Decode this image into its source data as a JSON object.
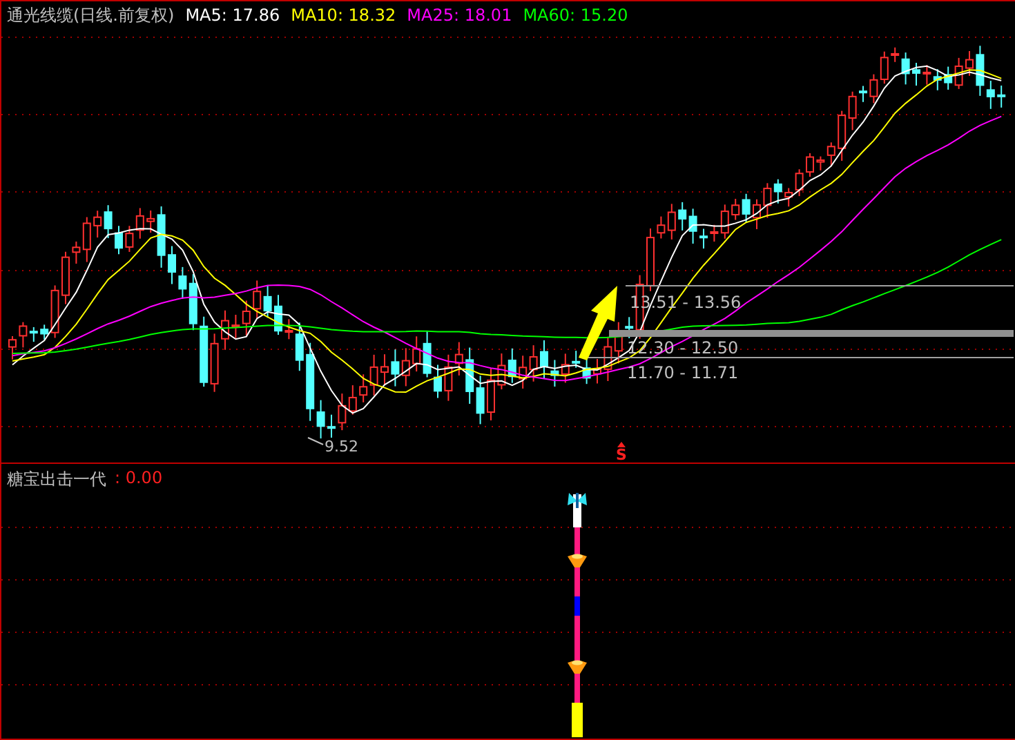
{
  "header": {
    "title": "通光线缆(日线.前复权)",
    "indicators": [
      {
        "label": "MA5: 17.86",
        "color": "#ffffff"
      },
      {
        "label": "MA10: 18.32",
        "color": "#ffff00"
      },
      {
        "label": "MA25: 18.01",
        "color": "#ff00ff"
      },
      {
        "label": "MA60: 15.20",
        "color": "#00ff00"
      }
    ]
  },
  "price_chart": {
    "range_labels": [
      "13.51 - 13.56",
      "12.30 - 12.50",
      "11.70 - 11.71"
    ],
    "low_label": "9.52",
    "signal_marker": "S"
  },
  "indicator_panel": {
    "title": "糖宝出击一代",
    "value": ": 0.00"
  }
}
